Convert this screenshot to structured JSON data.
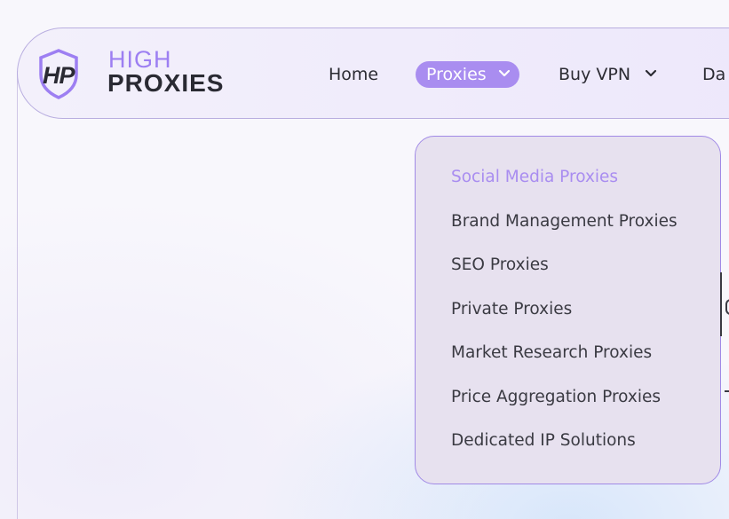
{
  "logo": {
    "mark": "HP",
    "line1": "HIGH",
    "line2": "PROXIES"
  },
  "nav": {
    "home": "Home",
    "proxies": "Proxies",
    "buy_vpn": "Buy VPN",
    "partial": "Da"
  },
  "dropdown": {
    "items": [
      "Social Media Proxies",
      "Brand Management Proxies",
      "SEO Proxies",
      "Private Proxies",
      "Market Research Proxies",
      "Price Aggregation Proxies",
      "Dedicated IP Solutions"
    ],
    "active_index": 0
  },
  "colors": {
    "accent": "#a98df0",
    "dropdown_bg": "#e7e1ef",
    "text": "#2b2b33"
  },
  "icons": {
    "logo": "shield-hp-icon",
    "dropdown_caret": "chevron-down-icon"
  }
}
